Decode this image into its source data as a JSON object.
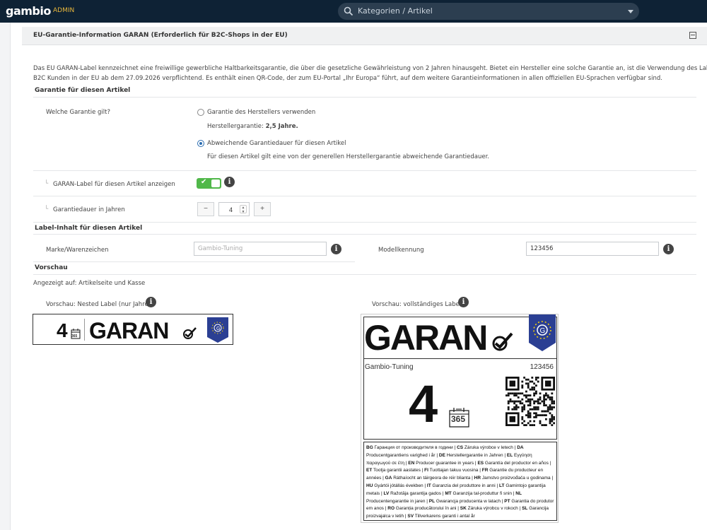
{
  "header": {
    "logo": "gambio",
    "admin": "ADMIN",
    "search_placeholder": "Kategorien / Artikel"
  },
  "panel": {
    "title": "EU-Garantie-Information GARAN (Erforderlich für B2C-Shops in der EU)",
    "intro_line1": "Das EU GARAN-Label kennzeichnet eine freiwillige gewerbliche Haltbarkeitsgarantie, die über die gesetzliche Gewährleistung von 2 Jahren hinausgeht. Bietet ein Hersteller eine solche Garantie an, ist die Verwendung des Labels für",
    "intro_line2": "B2C Kunden in der EU ab dem 27.09.2026 verpflichtend. Es enthält einen QR-Code, der zum EU-Portal „Ihr Europa“ führt, auf dem weitere Garantieinformationen in allen offiziellen EU-Sprachen verfügbar sind."
  },
  "section1": {
    "heading": "Garantie für diesen Artikel",
    "question": "Welche Garantie gilt?",
    "option1_label": "Garantie des Herstellers verwenden",
    "option1_note_prefix": "Herstellergarantie: ",
    "option1_note_value": "2,5 Jahre.",
    "option2_label": "Abweichende Garantiedauer für diesen Artikel",
    "option2_note": "Für diesen Artikel gilt eine von der generellen Herstellergarantie abweichende Garantiedauer.",
    "toggle_label": "GARAN-Label für diesen Artikel anzeigen",
    "toggle_check": "✔",
    "duration_label": "Garantiedauer in Jahren",
    "duration_minus": "−",
    "duration_value": "4",
    "duration_plus": "+",
    "prefix_glyph": "└"
  },
  "section2": {
    "heading": "Label-Inhalt für diesen Artikel",
    "brand_label": "Marke/Warenzeichen",
    "brand_placeholder": "Gambio-Tuning",
    "model_label": "Modellkennung",
    "model_value": "123456"
  },
  "section3": {
    "heading": "Vorschau",
    "shown_on": "Angezeigt auf: Artikelseite und Kasse",
    "nested_label": "Vorschau: Nested Label (nur Jahre)",
    "full_label": "Vorschau: vollständiges Label"
  },
  "preview": {
    "years": "4",
    "calendar_text": "365",
    "garan": "GARAN",
    "brand": "Gambio-Tuning",
    "model": "123456",
    "languages": [
      [
        "BG",
        "Гаранция от производителя в години"
      ],
      [
        "CS",
        "Záruka výrobce v letech"
      ],
      [
        "DA",
        "Producentgarantiens varighed i år"
      ],
      [
        "DE",
        "Herstellergarantie in Jahren"
      ],
      [
        "EL",
        "Εγγύηση παραγωγού σε έτη"
      ],
      [
        "EN",
        "Producer guarantee in years"
      ],
      [
        "ES",
        "Garantía del productor en años"
      ],
      [
        "ET",
        "Tootja garantii aastates"
      ],
      [
        "FI",
        "Tuottajan takuu vuosina"
      ],
      [
        "FR",
        "Garantie du producteur en années"
      ],
      [
        "GA",
        "Ráthaíocht an táirgeora de réir blianta"
      ],
      [
        "HR",
        "Jamstvo proizvođača u godinama"
      ],
      [
        "HU",
        "Gyártói jótállás években"
      ],
      [
        "IT",
        "Garanzia del produttore in anni"
      ],
      [
        "LT",
        "Gamintojo garantija metais"
      ],
      [
        "LV",
        "Ražotāja garantija gados"
      ],
      [
        "MT",
        "Garanzija tal-produttur fi snin"
      ],
      [
        "NL",
        "Producentengarantie in jaren"
      ],
      [
        "PL",
        "Gwarancja producenta w latach"
      ],
      [
        "PT",
        "Garantia do produtor em anos"
      ],
      [
        "RO",
        "Garanția producătorului în ani"
      ],
      [
        "SK",
        "Záruka výrobcu v rokoch"
      ],
      [
        "SL",
        "Garancija proizvajalca v letih"
      ],
      [
        "SV",
        "Tillverkarens garanti i antal år"
      ]
    ]
  },
  "colors": {
    "topbar": "#0e2235",
    "accent": "#e8b73c",
    "toggle_on": "#51b84a",
    "eu_blue": "#2b3f93"
  },
  "icons": [
    "search-icon",
    "chevron-down-icon",
    "collapse-icon",
    "info-icon",
    "checkmark-icon",
    "eu-flag-icon",
    "qr-code-icon",
    "calendar-icon"
  ]
}
